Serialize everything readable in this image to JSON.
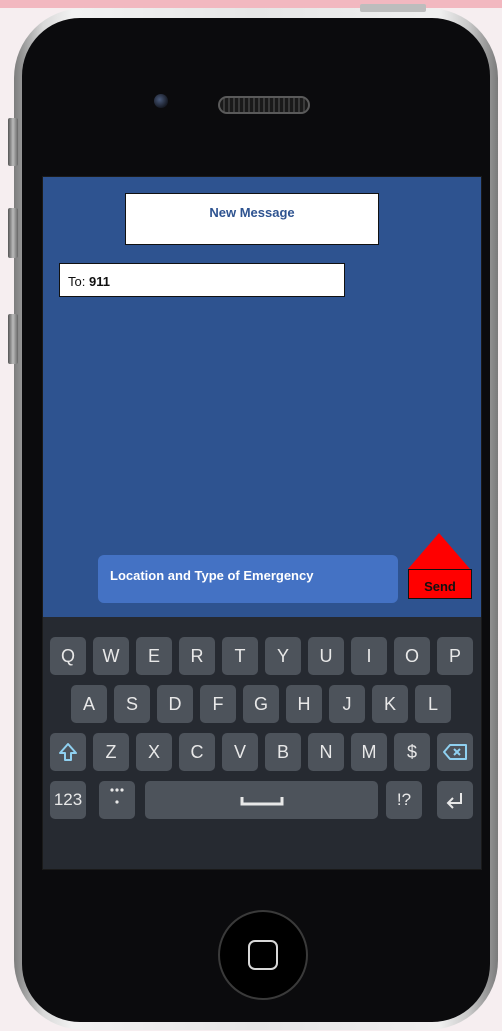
{
  "app": {
    "title": "New Message"
  },
  "compose": {
    "to_label": "To:",
    "to_value": "911",
    "message": "Location and Type of Emergency",
    "send_label": "Send"
  },
  "colors": {
    "screen_bg": "#2e5390",
    "message_bubble": "#4472c4",
    "send": "#ff0000",
    "keyboard_bg": "#262a31",
    "key_bg": "#4d535b",
    "accent_key": "#8fd0f0"
  },
  "keyboard": {
    "row1": [
      "Q",
      "W",
      "E",
      "R",
      "T",
      "Y",
      "U",
      "I",
      "O",
      "P"
    ],
    "row2": [
      "A",
      "S",
      "D",
      "F",
      "G",
      "H",
      "J",
      "K",
      "L"
    ],
    "row3": [
      "Z",
      "X",
      "C",
      "V",
      "B",
      "N",
      "M",
      "$"
    ],
    "row4": {
      "numbers": "123",
      "punct": "!?"
    }
  },
  "icons": [
    "shift-icon",
    "backspace-icon",
    "space-icon",
    "return-icon",
    "ellipsis-icon",
    "home-button-icon"
  ]
}
